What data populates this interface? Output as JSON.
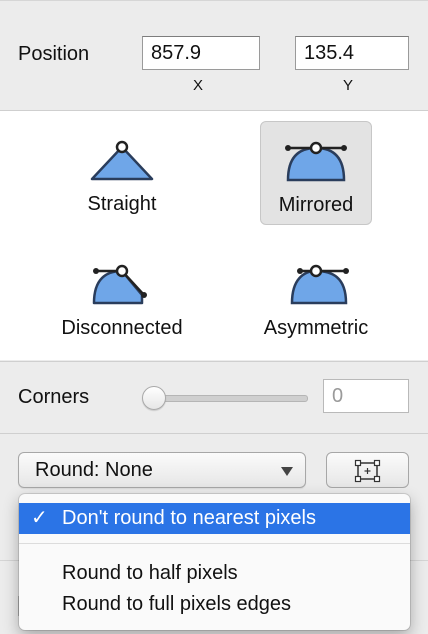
{
  "position": {
    "label": "Position",
    "x_value": "857.9",
    "y_value": "135.4",
    "x_label": "X",
    "y_label": "Y"
  },
  "curve_modes": [
    {
      "label": "Straight",
      "icon": "straight-point-icon",
      "selected": false
    },
    {
      "label": "Mirrored",
      "icon": "mirrored-point-icon",
      "selected": true
    },
    {
      "label": "Disconnected",
      "icon": "disconnected-point-icon",
      "selected": false
    },
    {
      "label": "Asymmetric",
      "icon": "asymmetric-point-icon",
      "selected": false
    }
  ],
  "corners": {
    "label": "Corners",
    "value": "0",
    "slider_fraction": 0
  },
  "round_dropdown": {
    "selected_label": "Round: None",
    "options": [
      {
        "label": "Don't round to nearest pixels",
        "checked": true,
        "highlighted": true
      },
      {
        "label": "Round to half pixels",
        "checked": false,
        "highlighted": false
      },
      {
        "label": "Round to full pixels edges",
        "checked": false,
        "highlighted": false
      }
    ],
    "check_glyph": "✓"
  },
  "pixel_button": {
    "icon": "pixel-grid-icon"
  },
  "colors": {
    "accent": "#2b74e6",
    "shape_fill": "#6fa6e8",
    "panel_bg": "#ececec"
  }
}
